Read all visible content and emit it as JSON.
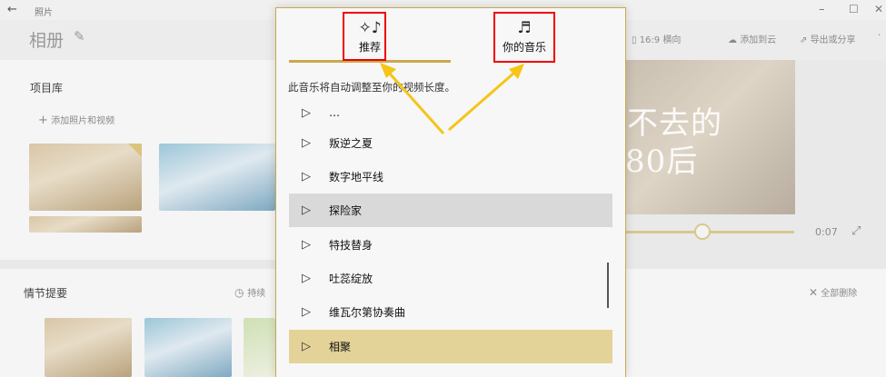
{
  "titlebar": {
    "back_glyph": "←",
    "app_name": "照片",
    "minimize": "–",
    "maximize": "☐",
    "close": "✕"
  },
  "header": {
    "title": "相册",
    "aspect_label": "16:9 横向",
    "add_cloud_label": "添加到云",
    "export_label": "导出或分享",
    "more_label": "·"
  },
  "library": {
    "title": "项目库",
    "add_label": "添加照片和视频",
    "add_glyph": "+"
  },
  "preview": {
    "line1": "不去的",
    "line2": "80后"
  },
  "playback": {
    "time": "0:07",
    "expand_glyph": "⤢"
  },
  "storyboard": {
    "title": "情节提要",
    "duration_label": "持续",
    "remove_all_label": "全部删除",
    "remove_glyph": "✕"
  },
  "music_popup": {
    "tabs": [
      {
        "label": "推荐",
        "icon": "sparkle-music-icon",
        "glyph": "✧♪"
      },
      {
        "label": "你的音乐",
        "icon": "person-music-icon",
        "glyph": "♬"
      }
    ],
    "hint": "此音乐将自动调整至你的视频长度。",
    "songs": [
      {
        "name": "…"
      },
      {
        "name": "叛逆之夏"
      },
      {
        "name": "数字地平线"
      },
      {
        "name": "探险家"
      },
      {
        "name": "特技替身"
      },
      {
        "name": "吐蕊绽放"
      },
      {
        "name": "维瓦尔第协奏曲"
      },
      {
        "name": "相聚"
      }
    ],
    "play_glyph": "▷"
  },
  "colors": {
    "accent": "#c9a94c",
    "selected_row": "#e3d398",
    "hover_row": "#d9d9d9",
    "annotation": "#f5c518",
    "highlight_box": "#e00000"
  }
}
